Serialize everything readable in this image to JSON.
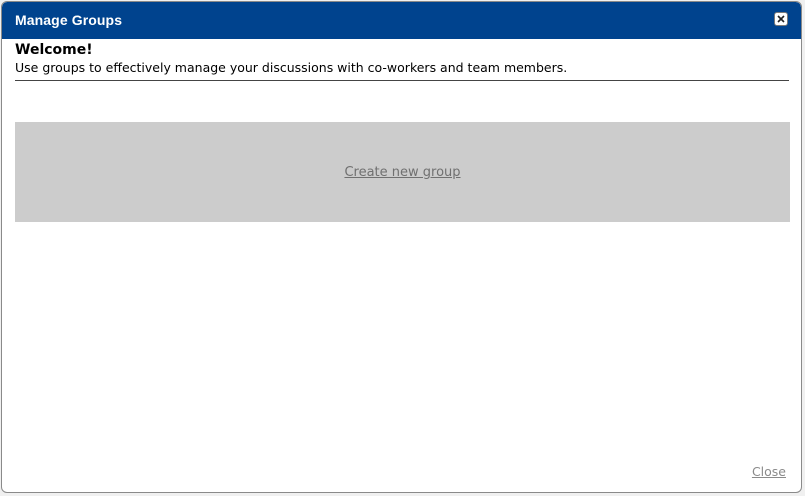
{
  "dialog": {
    "title": "Manage Groups",
    "close_icon": "close-icon",
    "welcome_heading": "Welcome!",
    "welcome_text": "Use groups to effectively manage your discussions with co-workers and team members.",
    "create_group_link": "Create new group",
    "close_link": "Close"
  },
  "colors": {
    "titlebar": "#00438e",
    "panel": "#cccccc",
    "link": "#707070"
  }
}
